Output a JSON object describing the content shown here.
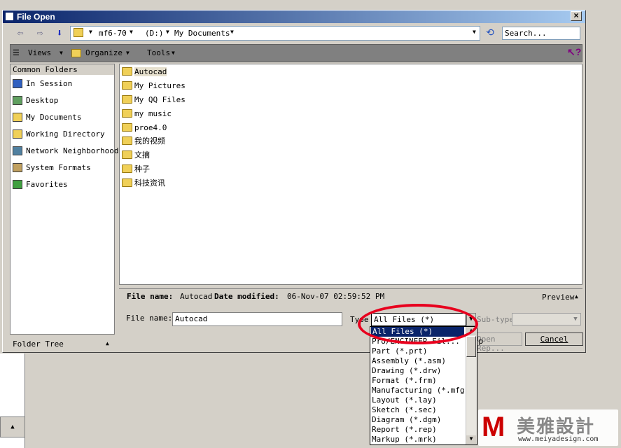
{
  "window": {
    "title": "File Open"
  },
  "nav": {
    "back": "⇦",
    "forward": "⇨",
    "path_parts": [
      "mf6-70",
      "(D:)",
      "My Documents"
    ],
    "search_placeholder": "Search..."
  },
  "toolbar": {
    "views": "Views",
    "organize": "Organize",
    "tools": "Tools"
  },
  "left_pane": {
    "header": "Common Folders",
    "items": [
      "In Session",
      "Desktop",
      "My Documents",
      "Working Directory",
      "Network Neighborhood",
      "System Formats",
      "Favorites"
    ],
    "footer": "Folder Tree"
  },
  "files": [
    "Autocad",
    "My Pictures",
    "My QQ Files",
    "my music",
    "proe4.0",
    "我的视频",
    "文摘",
    "种子",
    "科技资讯"
  ],
  "status": {
    "name_label": "File name:",
    "name_value": "Autocad",
    "date_label": "Date modified:",
    "date_value": "06-Nov-07 02:59:52 PM",
    "preview": "Preview"
  },
  "form": {
    "file_name_label": "File name:",
    "file_name_value": "Autocad",
    "type_label": "Type",
    "type_value": "All Files (*)",
    "subtype_label": "Sub-type",
    "open_rep": "Open Rep...",
    "cancel": "Cancel"
  },
  "dropdown": {
    "items": [
      "All Files (*)",
      "Pro/ENGINEER Fil... (*.p",
      "Part (*.prt)",
      "Assembly (*.asm)",
      "Drawing (*.drw)",
      "Format (*.frm)",
      "Manufacturing (*.mfg)",
      "Layout (*.lay)",
      "Sketch (*.sec)",
      "Diagram (*.dgm)",
      "Report (*.rep)",
      "Markup (*.mrk)"
    ]
  },
  "watermark": {
    "logo": "M",
    "text": "美雅設計",
    "url": "www.meiyadesign.com"
  },
  "colors": {
    "title_start": "#0a246a",
    "title_end": "#a6caf0",
    "highlight": "#0a246a",
    "annotation": "#e8001e"
  }
}
